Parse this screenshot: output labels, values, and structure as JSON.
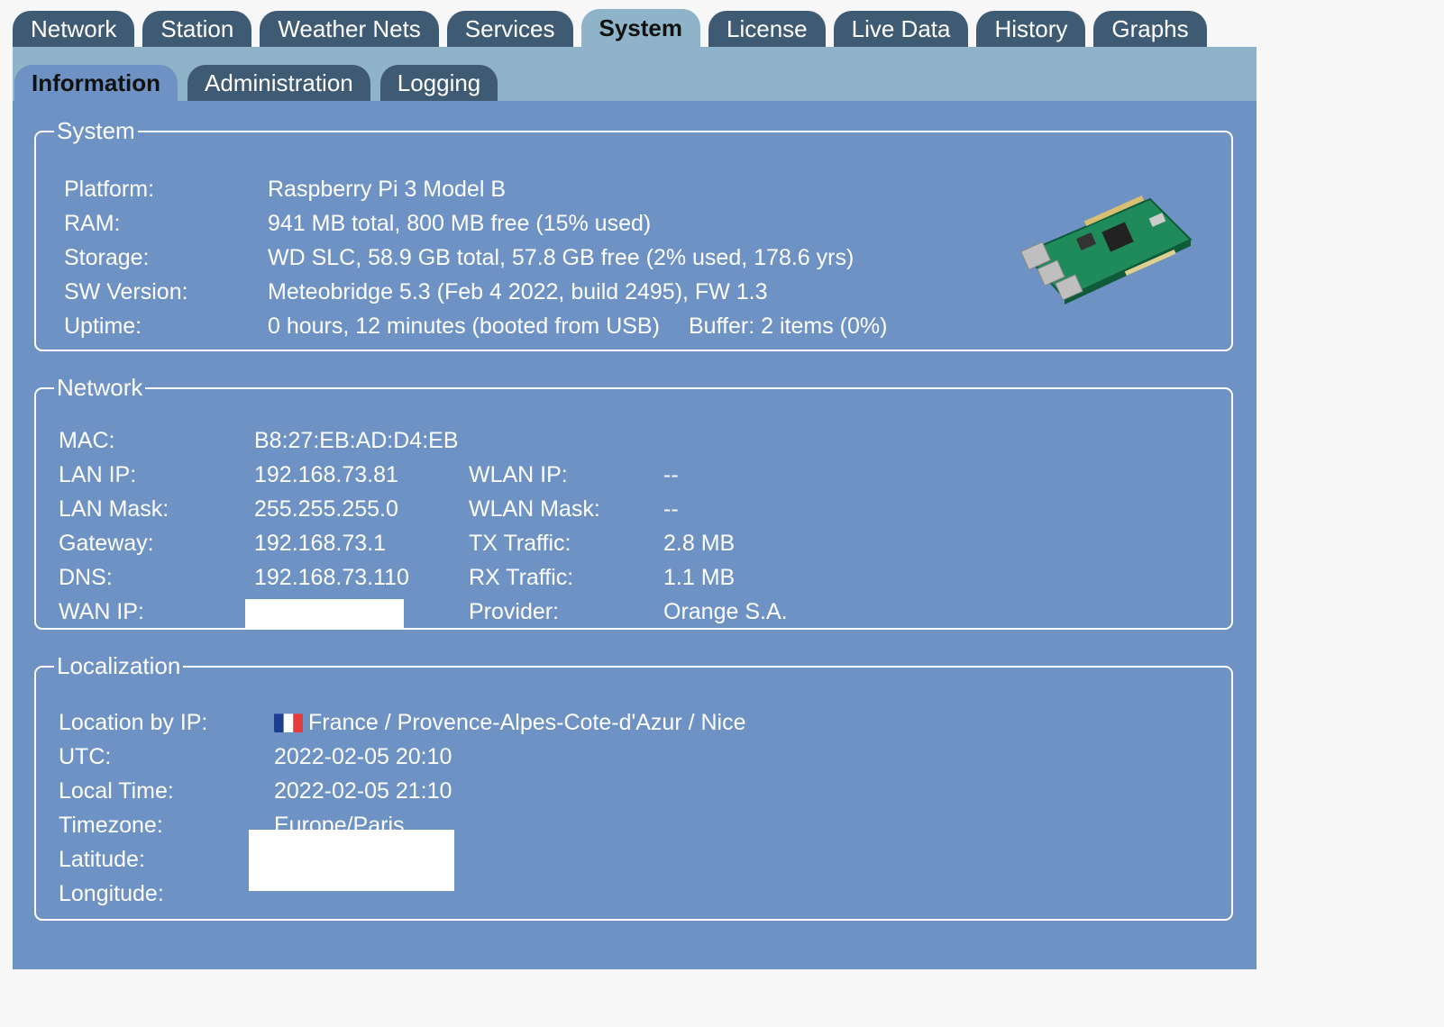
{
  "main_tabs": [
    {
      "label": "Network",
      "active": false
    },
    {
      "label": "Station",
      "active": false
    },
    {
      "label": "Weather Nets",
      "active": false
    },
    {
      "label": "Services",
      "active": false
    },
    {
      "label": "System",
      "active": true
    },
    {
      "label": "License",
      "active": false
    },
    {
      "label": "Live Data",
      "active": false
    },
    {
      "label": "History",
      "active": false
    },
    {
      "label": "Graphs",
      "active": false
    }
  ],
  "sub_tabs": [
    {
      "label": "Information",
      "active": true
    },
    {
      "label": "Administration",
      "active": false
    },
    {
      "label": "Logging",
      "active": false
    }
  ],
  "system": {
    "legend": "System",
    "platform_label": "Platform:",
    "platform": "Raspberry Pi 3 Model B",
    "ram_label": "RAM:",
    "ram": "941 MB total, 800 MB free (15% used)",
    "storage_label": "Storage:",
    "storage": "WD SLC, 58.9 GB total, 57.8 GB free (2% used, 178.6 yrs)",
    "sw_label": "SW Version:",
    "sw": "Meteobridge 5.3 (Feb 4 2022, build 2495), FW 1.3",
    "uptime_label": "Uptime:",
    "uptime": "0 hours, 12 minutes (booted from USB)",
    "buffer": "Buffer: 2 items (0%)",
    "image_icon": "raspberry-pi-board-icon"
  },
  "network": {
    "legend": "Network",
    "mac_label": "MAC:",
    "mac": "B8:27:EB:AD:D4:EB",
    "lan_ip_label": "LAN IP:",
    "lan_ip": "192.168.73.81",
    "lan_mask_label": "LAN Mask:",
    "lan_mask": "255.255.255.0",
    "gateway_label": "Gateway:",
    "gateway": "192.168.73.1",
    "dns_label": "DNS:",
    "dns": "192.168.73.110",
    "wan_ip_label": "WAN IP:",
    "wlan_ip_label": "WLAN IP:",
    "wlan_ip": "--",
    "wlan_mask_label": "WLAN Mask:",
    "wlan_mask": "--",
    "tx_label": "TX Traffic:",
    "tx": "2.8 MB",
    "rx_label": "RX Traffic:",
    "rx": "1.1 MB",
    "provider_label": "Provider:",
    "provider": "Orange S.A."
  },
  "localization": {
    "legend": "Localization",
    "location_label": "Location by IP:",
    "location": "France / Provence-Alpes-Cote-d'Azur / Nice",
    "flag_icon": "france-flag-icon",
    "utc_label": "UTC:",
    "utc": "2022-02-05 20:10",
    "local_label": "Local Time:",
    "local": "2022-02-05 21:10",
    "tz_label": "Timezone:",
    "tz": "Europe/Paris",
    "lat_label": "Latitude:",
    "lon_label": "Longitude:"
  },
  "colors": {
    "tab_bg": "#3f5a73",
    "tab_active": "#8fb3c8",
    "panel": "#6d92c3",
    "page_bg": "#f7f7f7"
  }
}
